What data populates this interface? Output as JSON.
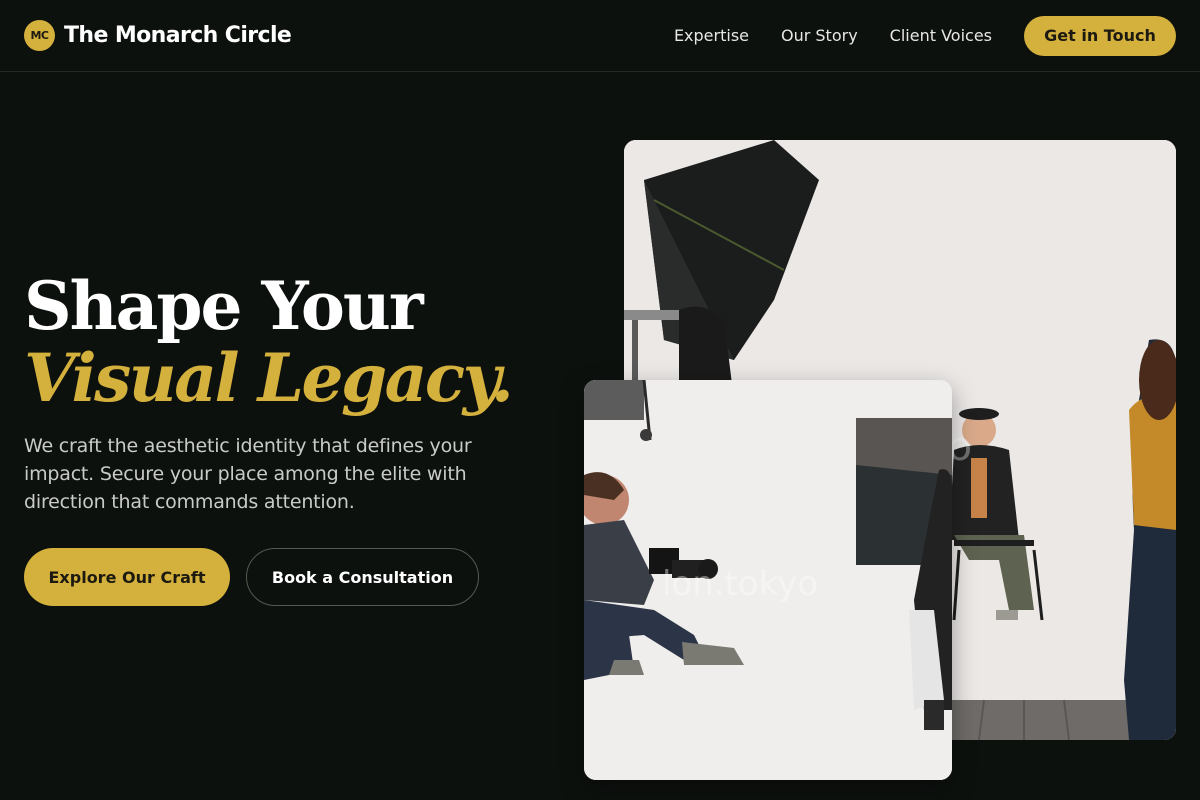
{
  "brand": {
    "logo_initials": "MC",
    "name": "The Monarch Circle"
  },
  "nav": {
    "links": [
      "Expertise",
      "Our Story",
      "Client Voices"
    ],
    "cta_label": "Get in Touch"
  },
  "hero": {
    "title_line1": "Shape Your",
    "title_line2": "Visual Legacy.",
    "subtitle": "We craft the aesthetic identity that defines your impact. Secure your place among the elite with direction that commands attention.",
    "primary_button": "Explore Our Craft",
    "secondary_button": "Book a Consultation"
  },
  "colors": {
    "background": "#0d110e",
    "accent": "#d4b03c",
    "text": "#ffffff",
    "muted_text": "#c9cbc6"
  },
  "images": {
    "back_photo": "photo-studio-shoot",
    "front_photo": "photo-photographer-crouching"
  }
}
